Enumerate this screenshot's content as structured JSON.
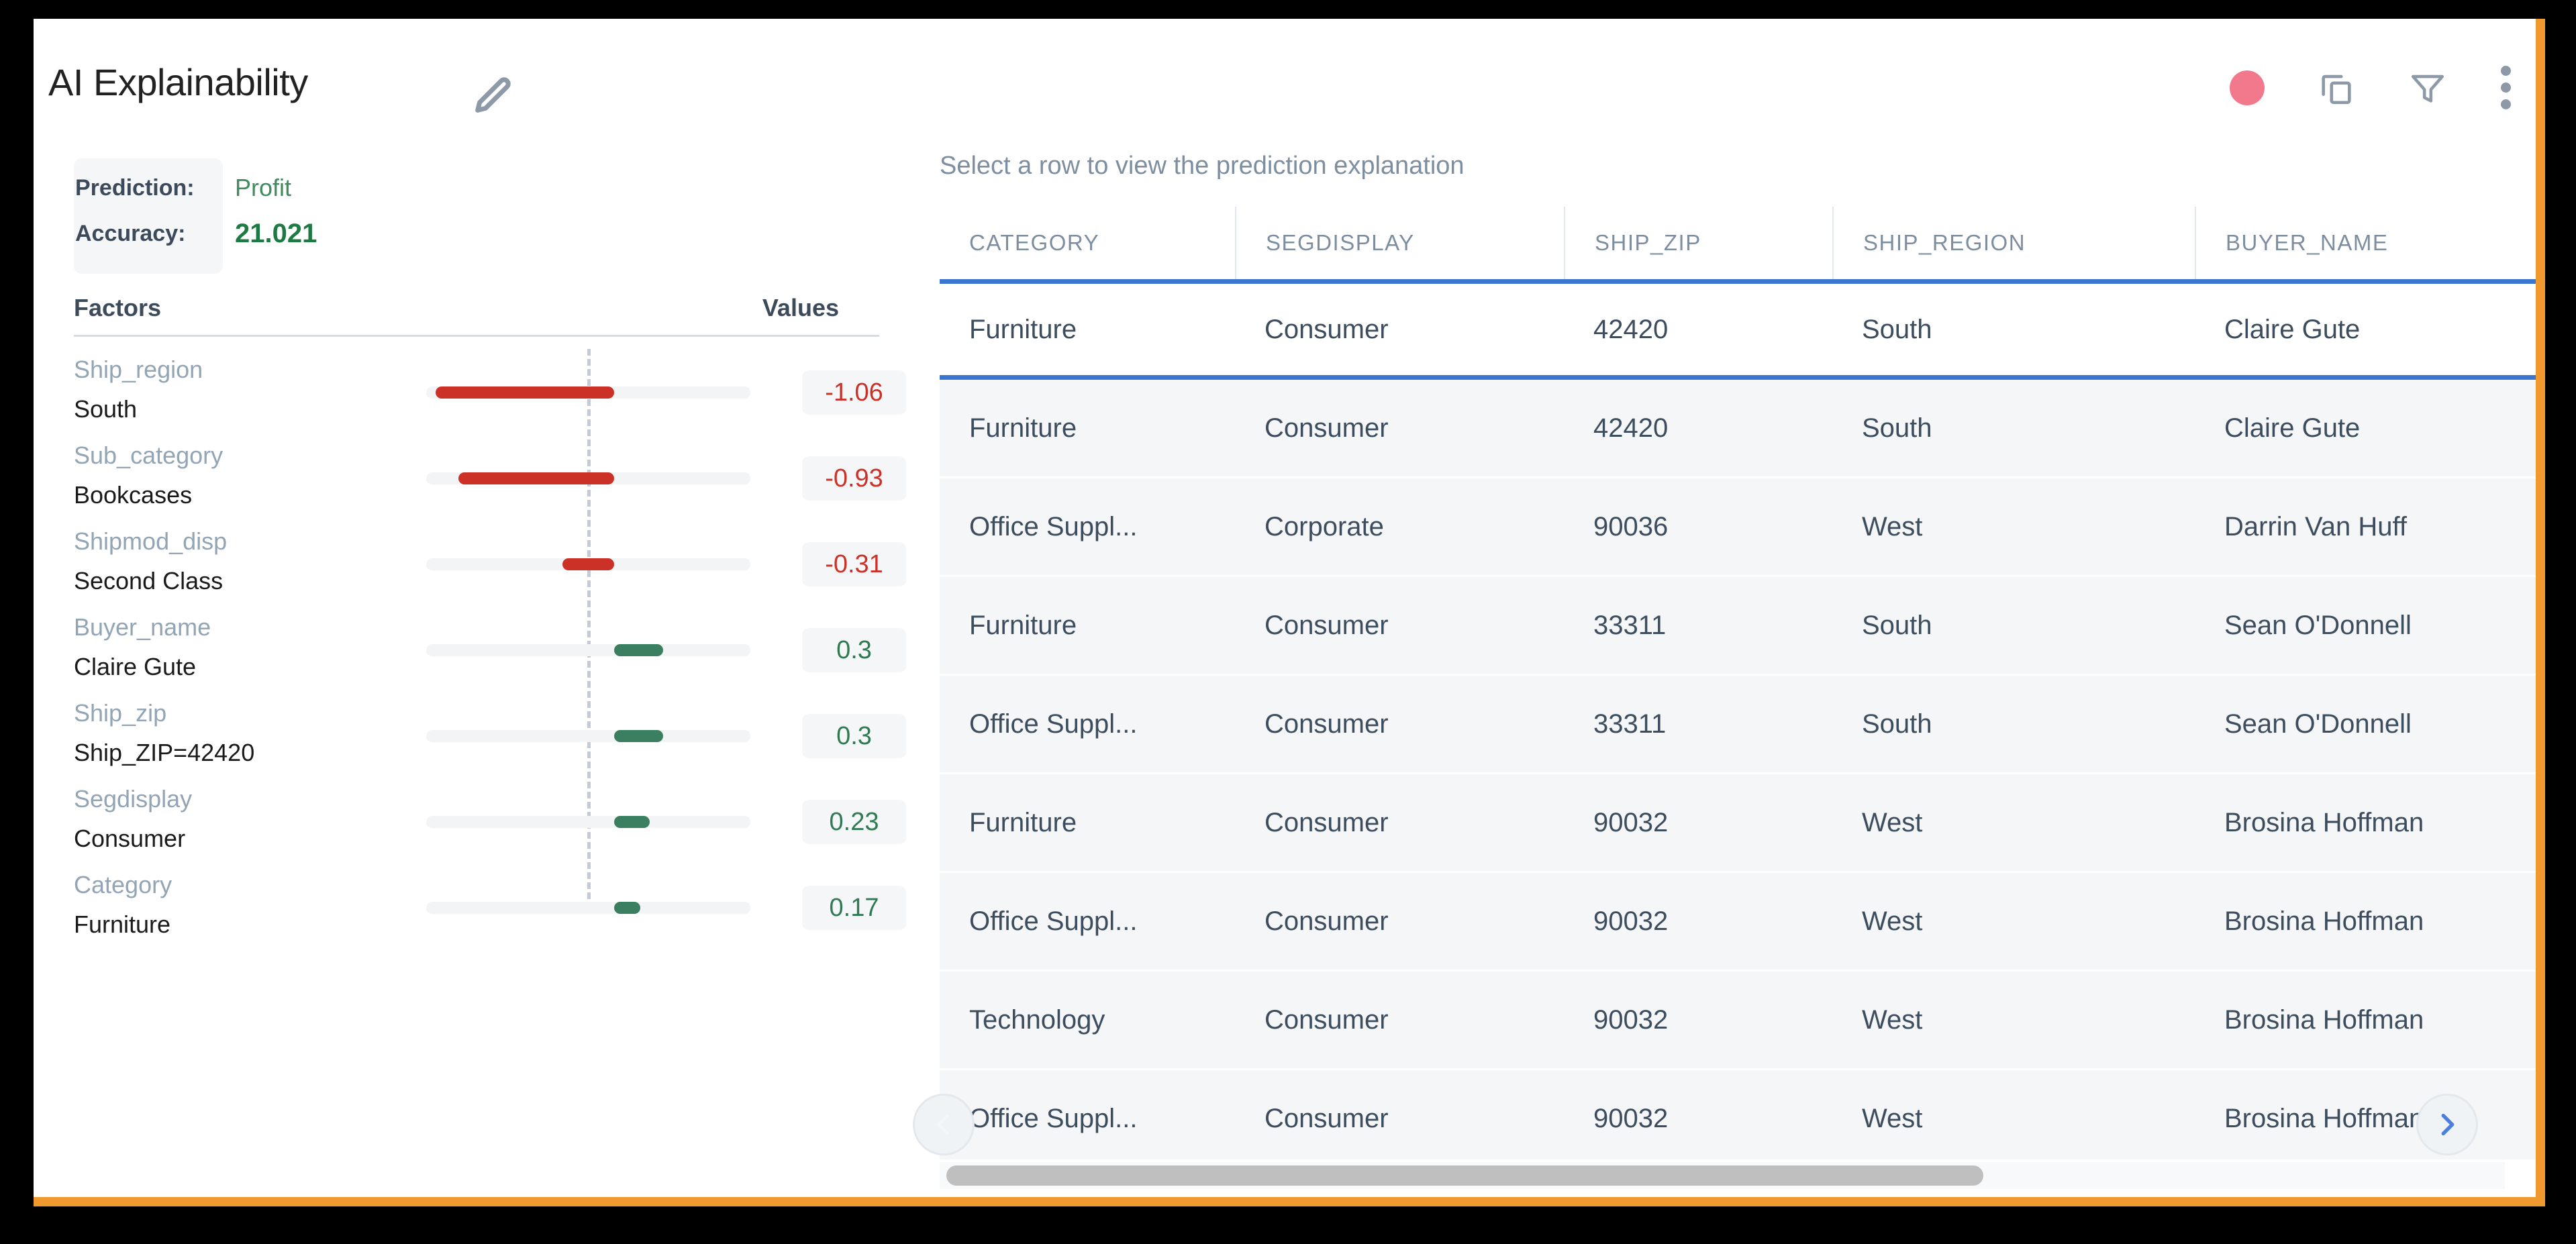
{
  "header": {
    "title": "AI Explainability",
    "edit_icon": "pencil-icon",
    "actions": [
      {
        "name": "record-dot-icon",
        "color": "#f2798c"
      },
      {
        "name": "copy-icon"
      },
      {
        "name": "filter-icon"
      },
      {
        "name": "more-vertical-icon"
      }
    ]
  },
  "prediction": {
    "prediction_label": "Prediction:",
    "accuracy_label": "Accuracy:",
    "prediction_value": "Profit",
    "accuracy_value": "21.021"
  },
  "factors_panel": {
    "col_factors": "Factors",
    "col_values": "Values"
  },
  "chart_data": {
    "type": "bar",
    "title": "Factors",
    "xlabel": "",
    "ylabel": "",
    "orientation": "horizontal",
    "axis_center": 0,
    "xlim": [
      -1.2,
      1.2
    ],
    "grid": false,
    "legend": "none",
    "categories": [
      "Ship_region",
      "Sub_category",
      "Shipmod_disp",
      "Buyer_name",
      "Ship_zip",
      "Segdisplay",
      "Category"
    ],
    "category_values": [
      "South",
      "Bookcases",
      "Second Class",
      "Claire Gute",
      "Ship_ZIP=42420",
      "Consumer",
      "Furniture"
    ],
    "values": [
      -1.06,
      -0.93,
      -0.31,
      0.3,
      0.3,
      0.23,
      0.17
    ],
    "value_labels": [
      "-1.06",
      "-0.93",
      "-0.31",
      "0.3",
      "0.3",
      "0.23",
      "0.17"
    ],
    "colors": {
      "negative": "#cc3128",
      "positive": "#3a8060",
      "track": "#f2f4f6"
    }
  },
  "factors": [
    {
      "name": "Ship_region",
      "value": "South",
      "amount": "-1.06",
      "sign": "neg",
      "pct": 55,
      "start": 3
    },
    {
      "name": "Sub_category",
      "value": "Bookcases",
      "amount": "-0.93",
      "sign": "neg",
      "pct": 48,
      "start": 10
    },
    {
      "name": "Shipmod_disp",
      "value": "Second Class",
      "amount": "-0.31",
      "sign": "neg",
      "pct": 16,
      "start": 42
    },
    {
      "name": "Buyer_name",
      "value": "Claire Gute",
      "amount": "0.3",
      "sign": "pos",
      "pct": 15,
      "start": 58
    },
    {
      "name": "Ship_zip",
      "value": "Ship_ZIP=42420",
      "amount": "0.3",
      "sign": "pos",
      "pct": 15,
      "start": 58
    },
    {
      "name": "Segdisplay",
      "value": "Consumer",
      "amount": "0.23",
      "sign": "pos",
      "pct": 11,
      "start": 58
    },
    {
      "name": "Category",
      "value": "Furniture",
      "amount": "0.17",
      "sign": "pos",
      "pct": 8,
      "start": 58
    }
  ],
  "table": {
    "hint": "Select a row to view the prediction explanation",
    "columns": [
      "CATEGORY",
      "SEGDISPLAY",
      "SHIP_ZIP",
      "SHIP_REGION",
      "BUYER_NAME"
    ],
    "rows": [
      {
        "selected": true,
        "cells": [
          "Furniture",
          "Consumer",
          "42420",
          "South",
          "Claire Gute"
        ]
      },
      {
        "selected": false,
        "cells": [
          "Furniture",
          "Consumer",
          "42420",
          "South",
          "Claire Gute"
        ]
      },
      {
        "selected": false,
        "cells": [
          "Office Suppl...",
          "Corporate",
          "90036",
          "West",
          "Darrin Van Huff"
        ]
      },
      {
        "selected": false,
        "cells": [
          "Furniture",
          "Consumer",
          "33311",
          "South",
          "Sean O'Donnell"
        ]
      },
      {
        "selected": false,
        "cells": [
          "Office Suppl...",
          "Consumer",
          "33311",
          "South",
          "Sean O'Donnell"
        ]
      },
      {
        "selected": false,
        "cells": [
          "Furniture",
          "Consumer",
          "90032",
          "West",
          "Brosina Hoffman"
        ]
      },
      {
        "selected": false,
        "cells": [
          "Office Suppl...",
          "Consumer",
          "90032",
          "West",
          "Brosina Hoffman"
        ]
      },
      {
        "selected": false,
        "cells": [
          "Technology",
          "Consumer",
          "90032",
          "West",
          "Brosina Hoffman"
        ]
      },
      {
        "selected": false,
        "cells": [
          "Office Suppl...",
          "Consumer",
          "90032",
          "West",
          "Brosina Hoffman"
        ]
      }
    ],
    "prev_arrow": "chevron-left-icon",
    "next_arrow": "chevron-right-icon"
  },
  "theme": {
    "accent_border": "#f0992f",
    "selection_blue": "#3a76cf",
    "positive_green": "#3a8060",
    "negative_red": "#cc3128"
  }
}
